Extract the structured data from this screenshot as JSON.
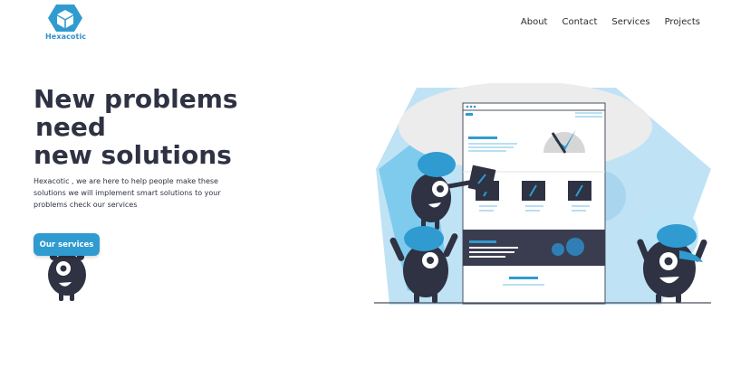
{
  "brand": {
    "name": "Hexacotic"
  },
  "nav": {
    "items": [
      "About",
      "Contact",
      "Services",
      "Projects"
    ]
  },
  "hero": {
    "title_line1": "New problems",
    "title_line2": "need",
    "title_line3": "new solutions",
    "description": "Hexacotic , we are here to help people make these solutions we will implement smart solutions to your problems check our services",
    "cta_label": "Our services"
  },
  "colors": {
    "accent": "#2f9bd0",
    "dark": "#2e3242",
    "light_blue": "#bfe3f5"
  }
}
